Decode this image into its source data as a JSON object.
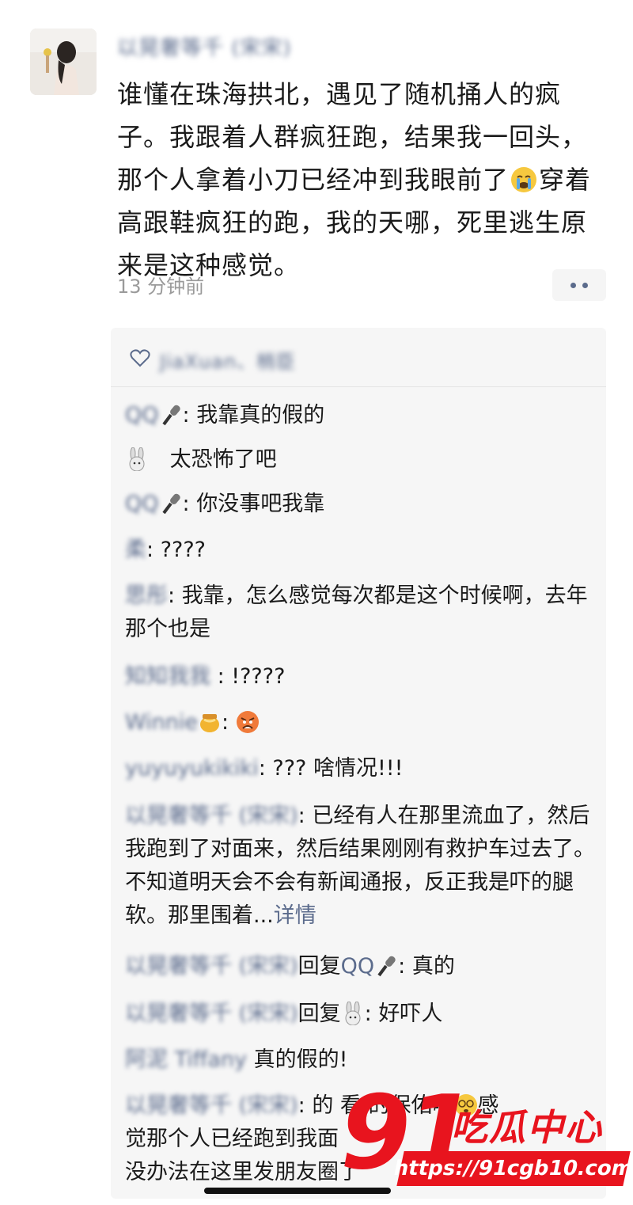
{
  "post": {
    "author_name": "以晃奢等千 (宋宋)",
    "text_part1": "谁懂在珠海拱北，遇见了随机捅人的疯子。我跟着人群疯狂跑，结果我一回头，那个人拿着小刀已经冲到我眼前了",
    "text_part2": "穿着高跟鞋疯狂的跑，我的天哪，死里逃生原来是这种感觉。",
    "timestamp": "13 分钟前"
  },
  "likes": {
    "names": "JiaXuan、梢臣"
  },
  "comments": [
    {
      "name": "QQ",
      "sep": ": ",
      "text": "我靠真的假的",
      "icon": "microphone-icon"
    },
    {
      "name": "",
      "sep": "",
      "text": "太恐怖了吧",
      "icon": "bunny-icon"
    },
    {
      "name": "QQ",
      "sep": ": ",
      "text": "你没事吧我靠",
      "icon": "microphone-icon"
    },
    {
      "name": "柔",
      "sep": ": ",
      "text": "????"
    },
    {
      "name": "思彤",
      "sep": ": ",
      "text": "我靠，怎么感觉每次都是这个时候啊，去年那个也是"
    },
    {
      "name": "知知我我",
      "sep": " : ",
      "text": "!????"
    },
    {
      "name": "Winnie",
      "sep": ": ",
      "text": "",
      "icon": "honey-pot-icon",
      "after_icon": "angry-face-icon"
    },
    {
      "name": "yuyuyukikiki",
      "sep": ": ",
      "text": "??? 啥情况!!!"
    },
    {
      "name": "以晃奢等千 (宋宋)",
      "sep": ": ",
      "text": "已经有人在那里流血了，然后我跑到了对面来，然后结果刚刚有救护车过去了。不知道明天会不会有新闻通报，反正我是吓的腿软。那里围着...",
      "more": "详情"
    },
    {
      "name": "以晃奢等千 (宋宋)",
      "sep": "",
      "reply_label": "回复",
      "reply_to": "QQ",
      "after": ": 真的",
      "icon": "microphone-icon"
    },
    {
      "name": "以晃奢等千 (宋宋)",
      "sep": "",
      "reply_label": "回复",
      "reply_to": "",
      "after": ": 好吓人",
      "icon": "bunny-icon"
    },
    {
      "name": "阿泥 Tiffany",
      "sep": " ",
      "text": "真的假的!"
    },
    {
      "name": "以晃奢等千 (宋宋)",
      "sep": ": ",
      "text": "的 看 的保佑啊",
      "line2": "觉那个人已经跑到我面",
      "line3": "没办法在这里发朋友圈了",
      "after_icon": "dizzy-face-icon",
      "tail": "感"
    }
  ],
  "watermark": {
    "number": "91",
    "brand": "吃瓜中心",
    "url": "https://91cgb10.com"
  },
  "colors": {
    "link_blue": "#5b6b8c",
    "comment_bg": "#f6f6f6",
    "watermark_red": "#e8141e"
  }
}
